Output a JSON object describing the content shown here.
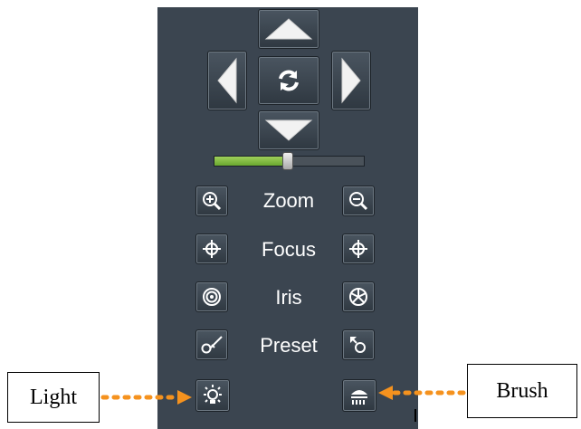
{
  "controls": {
    "zoom_label": "Zoom",
    "focus_label": "Focus",
    "iris_label": "Iris",
    "preset_label": "Preset"
  },
  "slider": {
    "value_fraction": 0.49
  },
  "callouts": {
    "light": "Light",
    "brush": "Brush"
  },
  "colors": {
    "panel": "#3b4550",
    "slider_fill": "#7ab63a",
    "arrow": "#f5921e"
  },
  "icons": {
    "pan_up": "triangle-up-icon",
    "pan_left": "triangle-left-icon",
    "pan_right": "triangle-right-icon",
    "pan_down": "triangle-down-icon",
    "home": "refresh-icon",
    "zoom_in": "zoom-in-icon",
    "zoom_out": "zoom-out-icon",
    "focus_near": "crosshair-icon",
    "focus_far": "crosshair-icon",
    "iris_open": "iris-open-icon",
    "iris_close": "iris-close-icon",
    "preset_set": "preset-set-icon",
    "preset_call": "preset-call-icon",
    "light": "light-icon",
    "brush": "wiper-icon"
  }
}
